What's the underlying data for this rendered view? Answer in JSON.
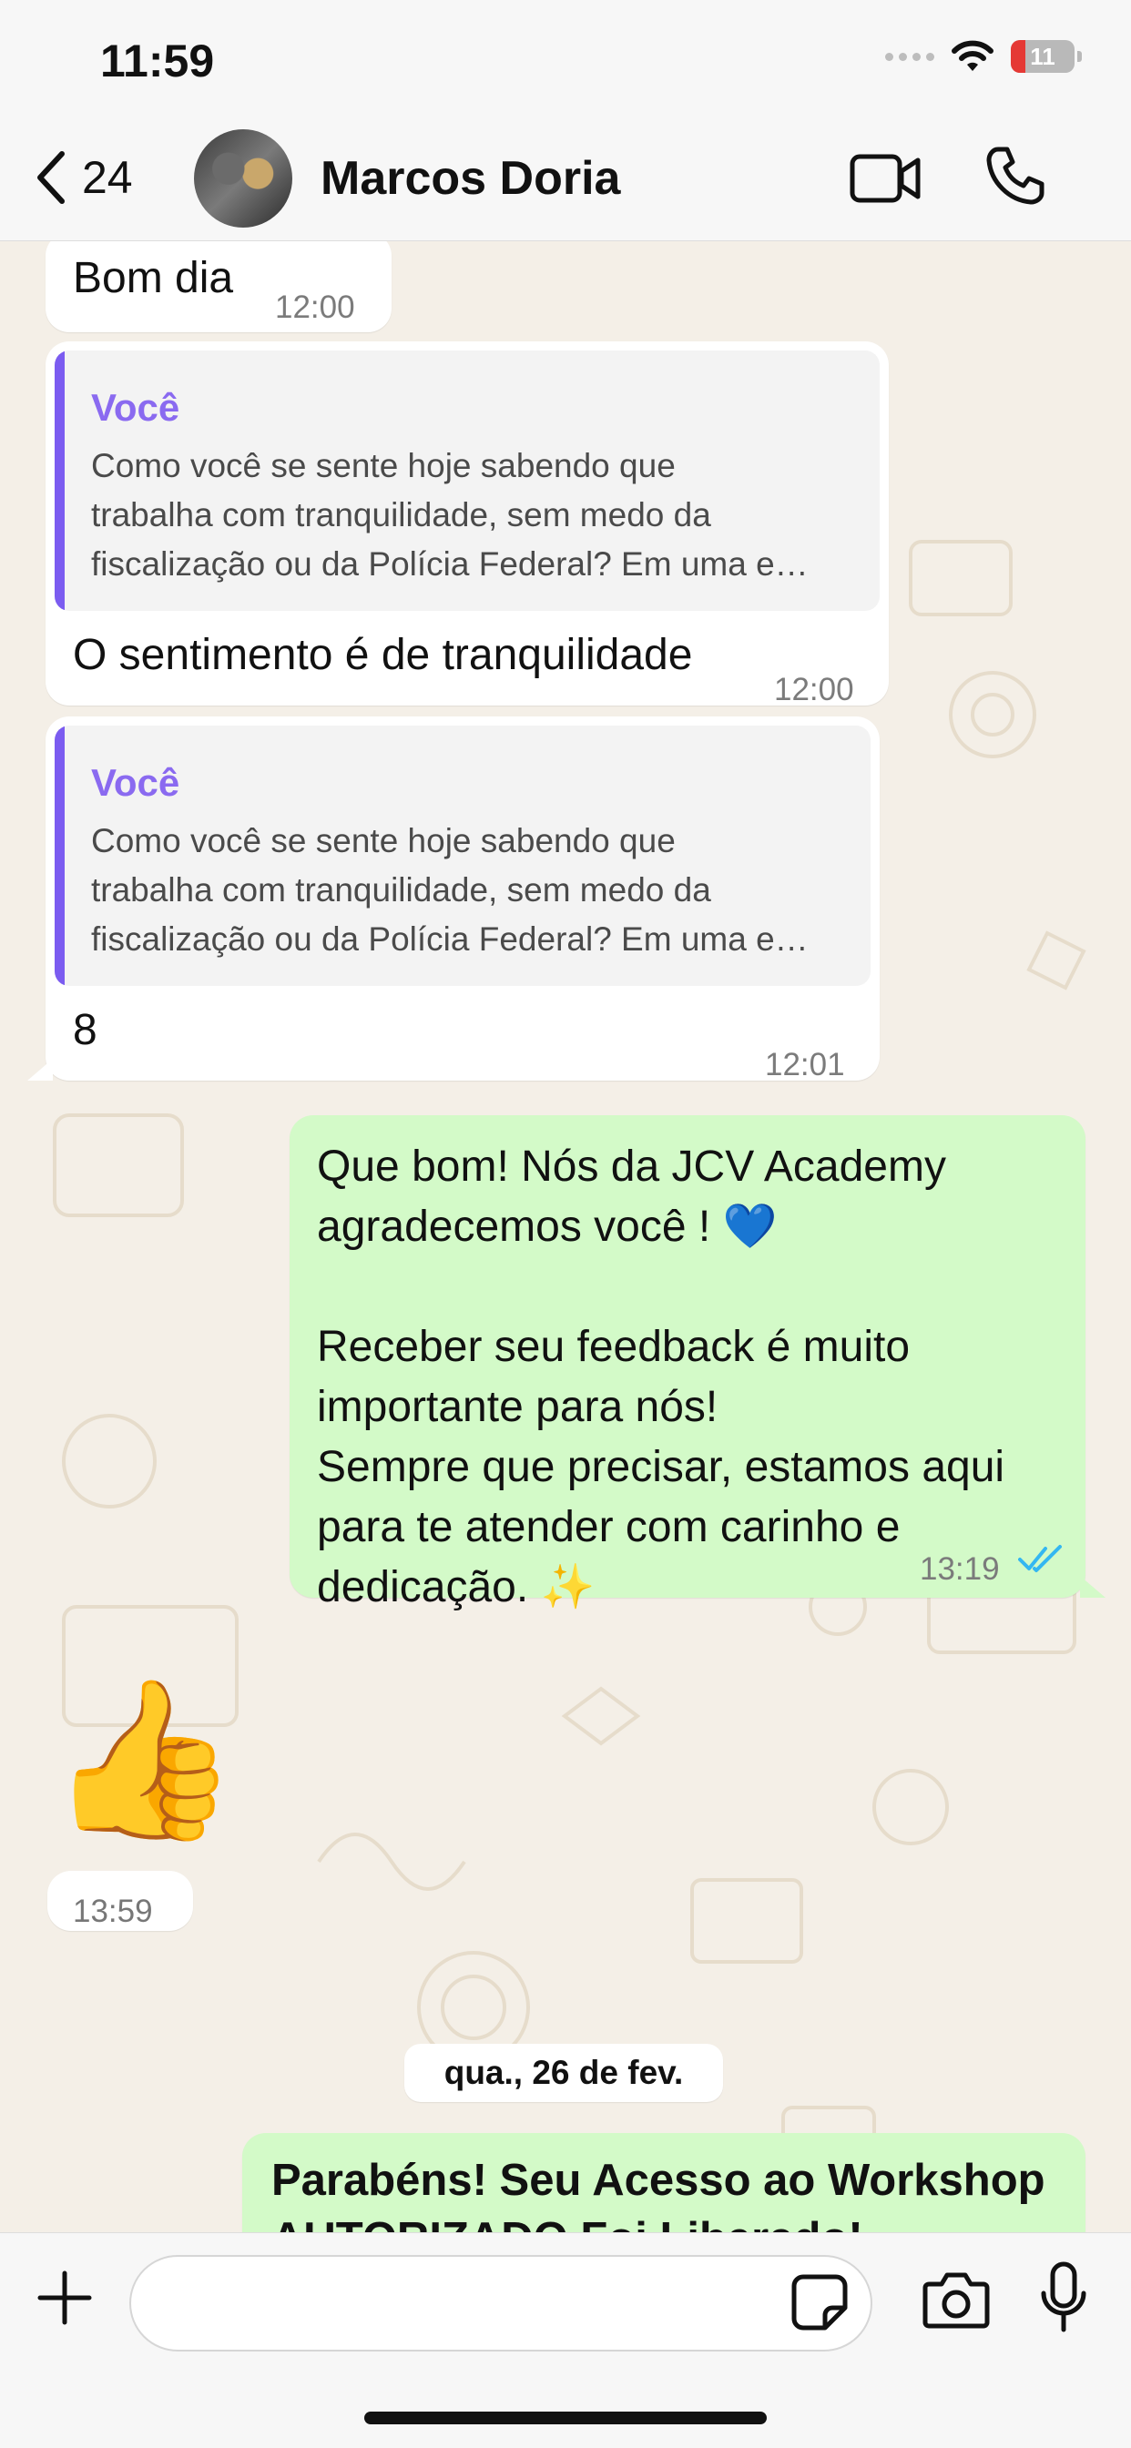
{
  "status_bar": {
    "time": "11:59",
    "battery": "11"
  },
  "header": {
    "back_count": "24",
    "contact_name": "Marcos Doria"
  },
  "messages": [
    {
      "direction": "in",
      "text": "Bom dia",
      "time": "12:00"
    },
    {
      "direction": "in",
      "quote_author": "Você",
      "quote_text": "Como você se sente hoje sabendo que\ntrabalha com tranquilidade, sem medo da\nfiscalização ou da Polícia Federal? Em uma e…",
      "text": "O sentimento é de tranquilidade",
      "time": "12:00"
    },
    {
      "direction": "in",
      "quote_author": "Você",
      "quote_text": "Como você se sente hoje sabendo que\ntrabalha com tranquilidade, sem medo da\nfiscalização ou da Polícia Federal? Em uma e…",
      "text": "8",
      "time": "12:01"
    },
    {
      "direction": "out",
      "lines": [
        "Que bom! Nós da JCV Academy",
        "agradecemos você ! 💙",
        "",
        "Receber seu feedback é muito",
        "importante para nós!",
        "Sempre que precisar, estamos aqui",
        "para te atender com carinho e",
        "dedicação. ✨"
      ],
      "time": "13:19",
      "status": "read"
    },
    {
      "direction": "in",
      "emoji": "👍",
      "time": "13:59"
    },
    {
      "direction": "out",
      "text": "Parabéns! Seu Acesso ao Workshop AUTORIZADO Foi Liberado!"
    }
  ],
  "date_separator": "qua., 26 de fev.",
  "composer": {
    "value": ""
  },
  "colors": {
    "outgoing_bubble": "#d3fac8",
    "incoming_bubble": "#ffffff",
    "quote_accent": "#7b5cf0",
    "read_ticks": "#34b7f1"
  }
}
